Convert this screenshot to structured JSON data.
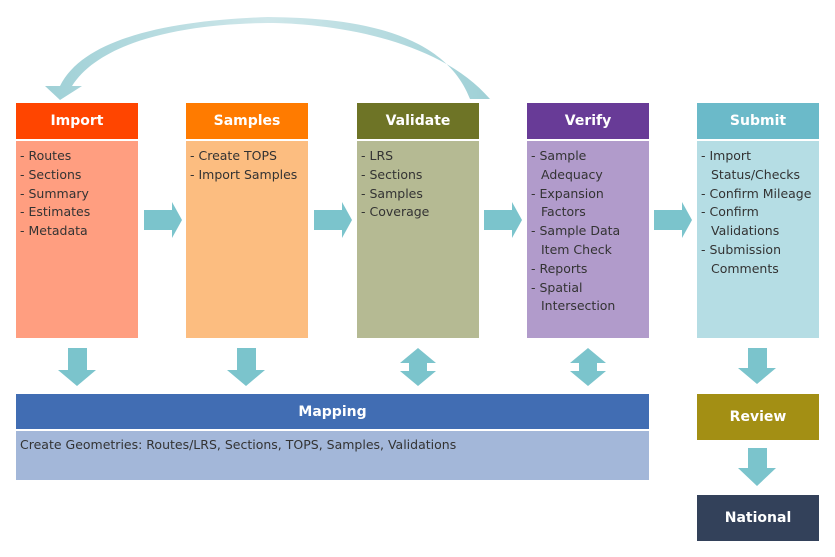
{
  "colors": {
    "arrow": "#7bc4cc",
    "import_header": "#ff4500",
    "import_body": "#ff9e80",
    "samples_header": "#ff7b00",
    "samples_body": "#fcbd80",
    "validate_header": "#6e7426",
    "validate_body": "#b5ba93",
    "verify_header": "#683b97",
    "verify_body": "#b19bcb",
    "submit_header": "#6bbac9",
    "submit_body": "#b5dde4",
    "mapping_header": "#416db3",
    "mapping_body": "#a3b7d9",
    "review": "#a38f14",
    "national": "#33415a"
  },
  "stages": [
    {
      "id": "import",
      "title": "Import",
      "items": [
        "Routes",
        "Sections",
        "Summary",
        "Estimates",
        "Metadata"
      ]
    },
    {
      "id": "samples",
      "title": "Samples",
      "items": [
        "Create TOPS",
        "Import Samples"
      ]
    },
    {
      "id": "validate",
      "title": "Validate",
      "items": [
        "LRS",
        "Sections",
        "Samples",
        "Coverage"
      ]
    },
    {
      "id": "verify",
      "title": "Verify",
      "items": [
        "Sample Adequacy",
        "Expansion Factors",
        "Sample Data Item Check",
        "Reports",
        "Spatial Intersection"
      ]
    },
    {
      "id": "submit",
      "title": "Submit",
      "items": [
        "Import Status/Checks",
        "Confirm Mileage",
        "Confirm Validations",
        "Submission Comments"
      ]
    }
  ],
  "mapping": {
    "title": "Mapping",
    "description": "Create Geometries: Routes/LRS, Sections, TOPS, Samples, Validations"
  },
  "review": {
    "title": "Review"
  },
  "national": {
    "title": "National"
  }
}
